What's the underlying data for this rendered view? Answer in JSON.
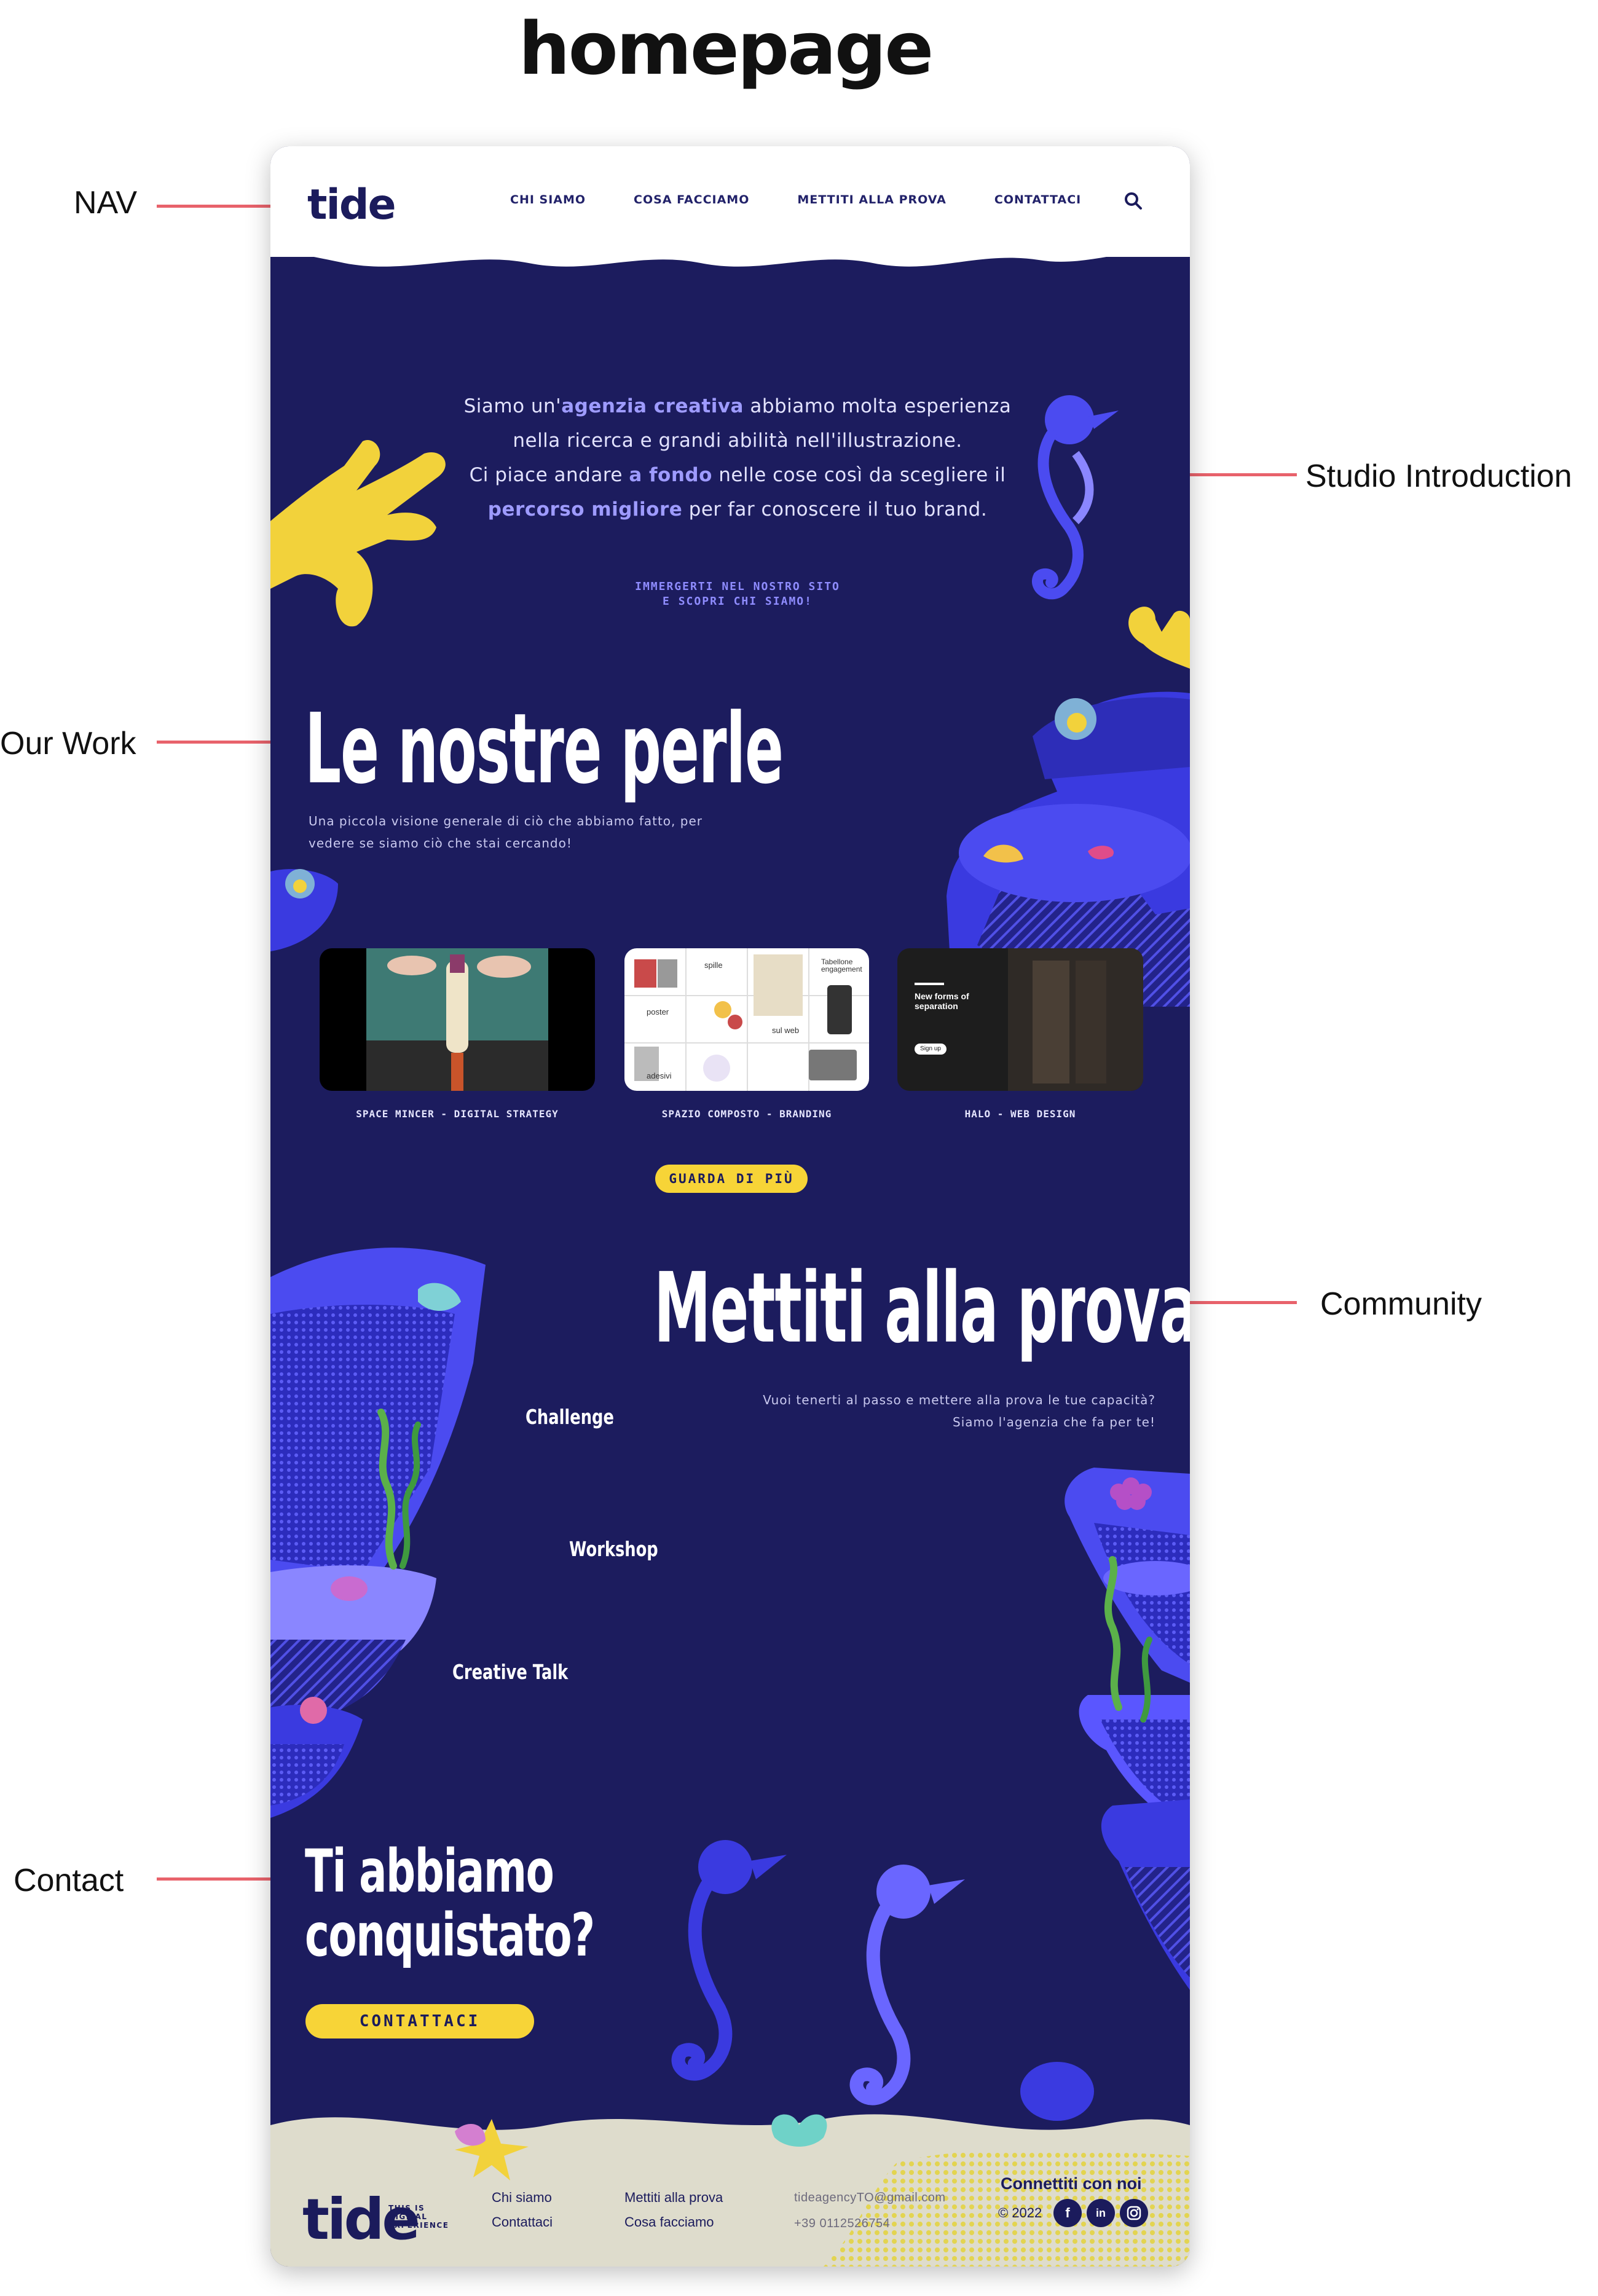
{
  "heading": "homepage",
  "annotations": {
    "nav": "NAV",
    "studio": "Studio Introduction",
    "work": "Our Work",
    "community": "Community",
    "contact": "Contact"
  },
  "nav": {
    "logo": "tide",
    "links": [
      "CHI SIAMO",
      "COSA FACCIAMO",
      "METTITI ALLA PROVA",
      "CONTATTACI"
    ],
    "search_icon": "search-icon"
  },
  "intro": {
    "line1_a": "Siamo un'",
    "line1_b": "agenzia creativa",
    "line1_c": " abbiamo molta esperienza",
    "line2": "nella ricerca e grandi abilità nell'illustrazione.",
    "line3_a": "Ci piace andare ",
    "line3_b": "a fondo",
    "line3_c": " nelle cose così da scegliere il",
    "line4_a": "percorso migliore",
    "line4_b": " per far conoscere il tuo brand.",
    "cta_line1": "IMMERGERTI NEL NOSTRO SITO",
    "cta_line2": "E SCOPRI CHI SIAMO!"
  },
  "work": {
    "title": "Le nostre perle",
    "description": "Una piccola visione generale di ciò che abbiamo fatto, per vedere se siamo ciò che stai cercando!",
    "projects": [
      {
        "label": "SPACE MINCER - DIGITAL STRATEGY"
      },
      {
        "label": "SPAZIO COMPOSTO - BRANDING",
        "tags": [
          "spille",
          "Tabellone engagement",
          "poster",
          "sul web",
          "adesivi"
        ]
      },
      {
        "label": "HALO - WEB DESIGN",
        "headline": "New forms of separation",
        "button": "Sign up"
      }
    ],
    "more_button": "GUARDA DI PIÙ"
  },
  "community": {
    "title": "Mettiti alla prova",
    "description_line1": "Vuoi tenerti al passo e mettere alla prova le tue capacità?",
    "description_line2": "Siamo l'agenzia che fa per te!",
    "events": [
      "Challenge",
      "Workshop",
      "Creative Talk"
    ]
  },
  "contact": {
    "title_line1": "Ti abbiamo",
    "title_line2": "conquistato?",
    "button": "CONTATTACI"
  },
  "footer": {
    "logo": "tide",
    "tagline": "THIS IS\nDIGITAL\nEXPERIENCE",
    "links_col1": [
      "Chi siamo",
      "Contattaci"
    ],
    "links_col2": [
      "Mettiti alla prova",
      "Cosa facciamo"
    ],
    "email": "tideagencyTO@gmail.com",
    "phone": "+39 0112526754",
    "connect": "Connettiti con noi",
    "copyright": "© 2022",
    "social_icons": [
      "facebook-icon",
      "linkedin-icon",
      "instagram-icon"
    ]
  },
  "colors": {
    "navy": "#1c1c5e",
    "accent_blue": "#4b4bf0",
    "light_blue": "#8f8cff",
    "yellow": "#f7d437",
    "sand": "#dedccc",
    "annotation_red": "#e04c58"
  }
}
